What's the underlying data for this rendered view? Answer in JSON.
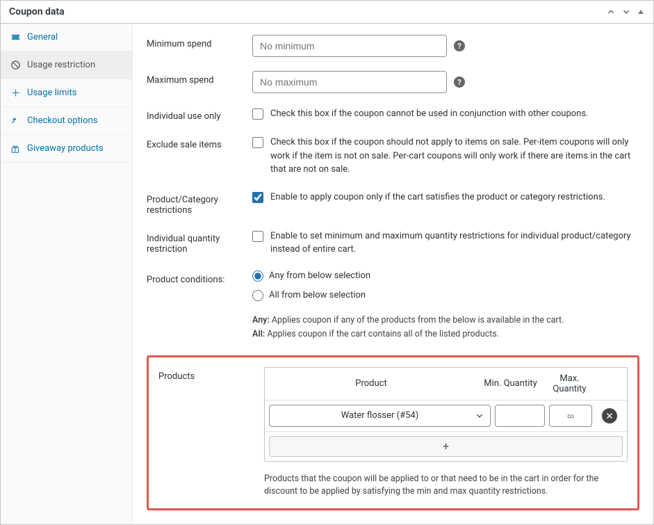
{
  "panel": {
    "title": "Coupon data"
  },
  "sidebar": {
    "items": [
      {
        "label": "General"
      },
      {
        "label": "Usage restriction"
      },
      {
        "label": "Usage limits"
      },
      {
        "label": "Checkout options"
      },
      {
        "label": "Giveaway products"
      }
    ]
  },
  "fields": {
    "min_spend": {
      "label": "Minimum spend",
      "placeholder": "No minimum"
    },
    "max_spend": {
      "label": "Maximum spend",
      "placeholder": "No maximum"
    },
    "individual_use": {
      "label": "Individual use only",
      "desc": "Check this box if the coupon cannot be used in conjunction with other coupons."
    },
    "exclude_sale": {
      "label": "Exclude sale items",
      "desc": "Check this box if the coupon should not apply to items on sale. Per-item coupons will only work if the item is not on sale. Per-cart coupons will only work if there are items in the cart that are not on sale."
    },
    "prod_cat": {
      "label": "Product/Category restrictions",
      "desc": "Enable to apply coupon only if the cart satisfies the product or category restrictions."
    },
    "ind_qty": {
      "label": "Individual quantity restriction",
      "desc": "Enable to set minimum and maximum quantity restrictions for individual product/category instead of entire cart."
    },
    "conditions": {
      "label": "Product conditions:",
      "opt_any": "Any from below selection",
      "opt_all": "All from below selection",
      "any_bold": "Any:",
      "any_text": " Applies coupon if any of the products from the below is available in the cart.",
      "all_bold": "All:",
      "all_text": " Applies coupon if the cart contains all of the listed products."
    },
    "products": {
      "label": "Products",
      "col_product": "Product",
      "col_min": "Min. Quantity",
      "col_max": "Max. Quantity",
      "selected": "Water flosser (#54)",
      "max_placeholder": "∞",
      "add": "+",
      "desc": "Products that the coupon will be applied to or that need to be in the cart in order for the discount to be applied by satisfying the min and max quantity restrictions."
    }
  }
}
